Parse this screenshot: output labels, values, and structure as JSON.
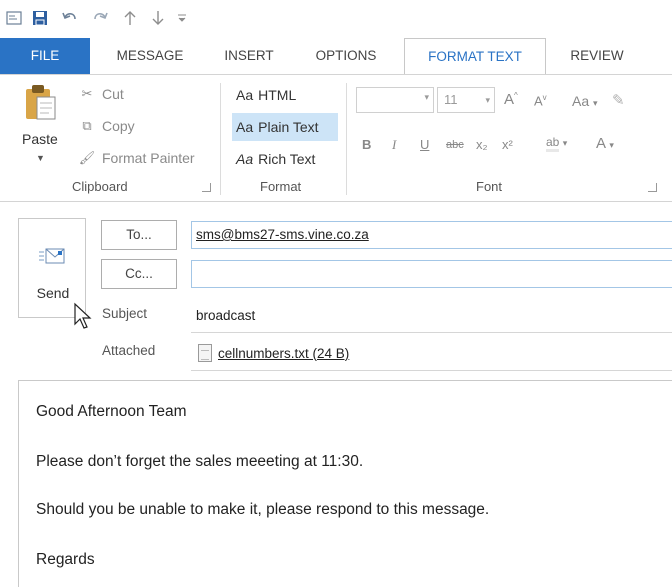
{
  "quick_access": {
    "icons": [
      "window-icon",
      "save-icon",
      "undo-icon",
      "redo-icon",
      "up-arrow-icon",
      "down-arrow-icon",
      "customize-icon"
    ]
  },
  "tabs": [
    {
      "label": "FILE"
    },
    {
      "label": "MESSAGE"
    },
    {
      "label": "INSERT"
    },
    {
      "label": "OPTIONS"
    },
    {
      "label": "FORMAT TEXT"
    },
    {
      "label": "REVIEW"
    }
  ],
  "active_tab": "FORMAT TEXT",
  "clipboard": {
    "paste": "Paste",
    "cut": "Cut",
    "copy": "Copy",
    "format_painter": "Format Painter",
    "group_label": "Clipboard"
  },
  "format": {
    "aa_prefix": "Aa",
    "html": "HTML",
    "plain_text": "Plain Text",
    "rich_text": "Rich Text",
    "selected": "Plain Text",
    "group_label": "Format"
  },
  "font": {
    "size": "11",
    "bold": "B",
    "italic": "I",
    "underline": "U",
    "strike": "abc",
    "subscript": "x₂",
    "superscript": "x²",
    "change_case": "Aa",
    "font_color": "A",
    "highlight": "ab",
    "grow": "A",
    "shrink": "A",
    "group_label": "Font"
  },
  "header": {
    "send": "Send",
    "to_button": "To...",
    "cc_button": "Cc...",
    "to_value": "sms@bms27-sms.vine.co.za",
    "cc_value": "",
    "subject_label": "Subject",
    "subject_value": "broadcast",
    "attached_label": "Attached",
    "attachment": "cellnumbers.txt (24 B)"
  },
  "body": {
    "lines": [
      "Good Afternoon Team",
      "Please don’t forget the sales meeeting at 11:30.",
      "Should you be unable to make it, please respond to this message.",
      "Regards"
    ]
  },
  "colors": {
    "accent": "#2a73c5",
    "selected_format": "#cde4f7",
    "field_border": "#a3c6e6"
  }
}
